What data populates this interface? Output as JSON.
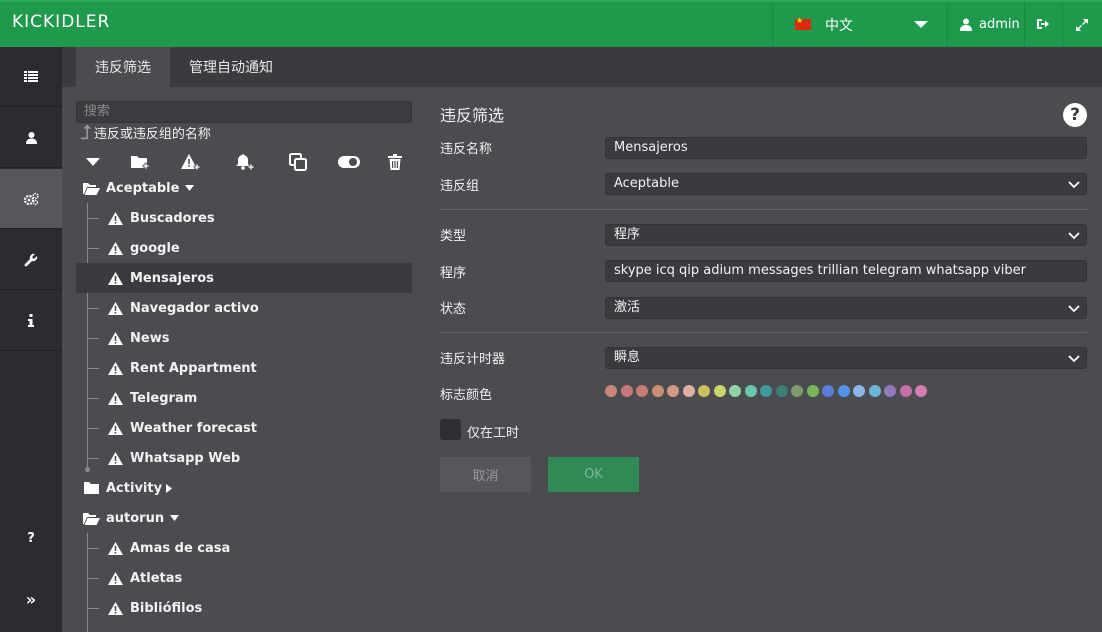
{
  "app": {
    "logo": "KICKIDLER"
  },
  "header": {
    "language": "中文",
    "user": "admin"
  },
  "sidebar": {
    "items": [
      {
        "icon": "list-icon"
      },
      {
        "icon": "user-icon"
      },
      {
        "icon": "gears-icon",
        "active": true
      },
      {
        "icon": "wrench-icon"
      },
      {
        "icon": "info-icon"
      }
    ],
    "help": "?",
    "collapse": "»"
  },
  "tabs": [
    {
      "label": "违反筛选",
      "active": true
    },
    {
      "label": "管理自动通知",
      "active": false
    }
  ],
  "tree": {
    "search_placeholder": "搜索",
    "search_hint": "违反或违反组的名称",
    "groups": [
      {
        "name": "Aceptable",
        "expanded": true,
        "items": [
          "Buscadores",
          "google",
          "Mensajeros",
          "Navegador activo",
          "News",
          "Rent Appartment",
          "Telegram",
          "Weather forecast",
          "Whatsapp Web"
        ]
      },
      {
        "name": "Activity",
        "expanded": false,
        "items": []
      },
      {
        "name": "autorun",
        "expanded": true,
        "items": [
          "Amas de casa",
          "Atletas",
          "Bibliófilos"
        ]
      }
    ],
    "selected": "Mensajeros"
  },
  "form": {
    "title": "违反筛选",
    "help": "?",
    "fields": {
      "name_label": "违反名称",
      "name_value": "Mensajeros",
      "group_label": "违反组",
      "group_value": "Aceptable",
      "type_label": "类型",
      "type_value": "程序",
      "programs_label": "程序",
      "programs_value": "skype icq qip adium messages trillian telegram whatsapp viber",
      "status_label": "状态",
      "status_value": "激活",
      "timer_label": "违反计时器",
      "timer_value": "瞬息",
      "color_label": "标志颜色",
      "worktime_label": "仅在工时"
    },
    "colors": [
      "#c9877a",
      "#c9777a",
      "#c87c74",
      "#c9906f",
      "#d49a82",
      "#e2b0a2",
      "#cbbf5e",
      "#c6d66a",
      "#8fd3a5",
      "#6bc7b0",
      "#3e9b9b",
      "#3d7d72",
      "#7f9a6c",
      "#79b65a",
      "#5b7fd8",
      "#4e95e6",
      "#8fb5e7",
      "#6bb5d9",
      "#9279bb",
      "#c46fa6",
      "#d77eb1"
    ],
    "buttons": {
      "cancel": "取消",
      "ok": "OK"
    }
  }
}
